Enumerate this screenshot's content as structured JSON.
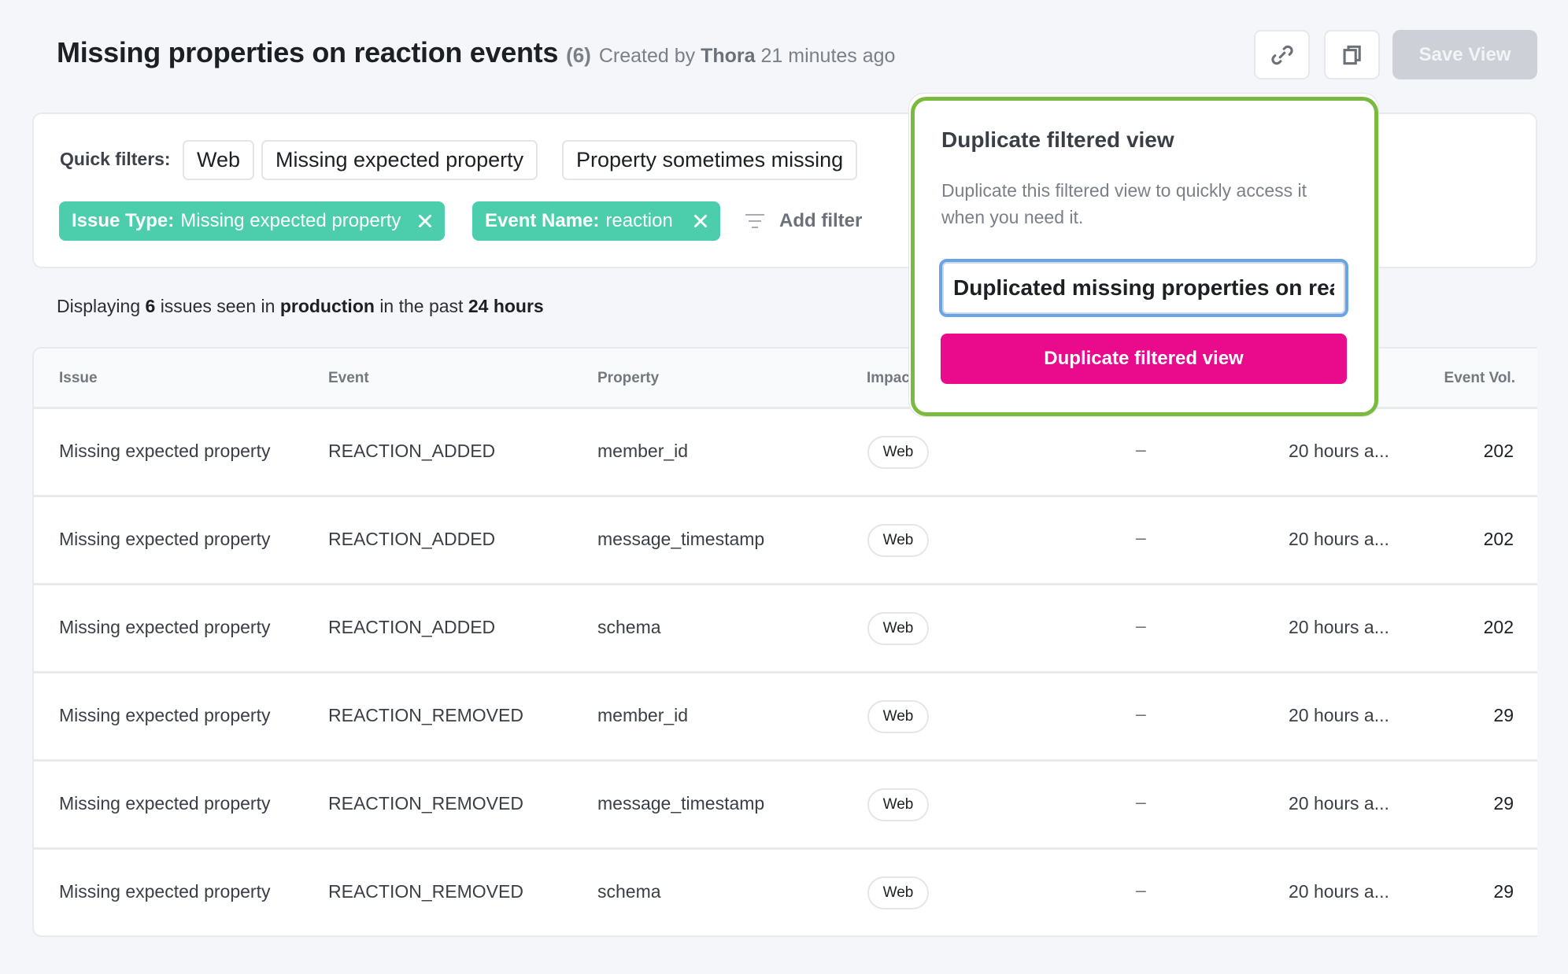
{
  "header": {
    "title": "Missing properties on reaction events",
    "count": "(6)",
    "created_prefix": "Created by",
    "creator": "Thora",
    "created_time": "21 minutes ago",
    "copy_link_icon": "link-icon",
    "duplicate_icon": "copy-icon",
    "save_label": "Save View"
  },
  "filters": {
    "quick_label": "Quick filters:",
    "quick": [
      "Web",
      "Missing expected property",
      "Property sometimes missing"
    ],
    "active": [
      {
        "key": "Issue Type:",
        "value": "Missing expected property"
      },
      {
        "key": "Event Name:",
        "value": "reaction"
      }
    ],
    "add_label": "Add filter"
  },
  "summary": {
    "prefix": "Displaying",
    "count": "6",
    "mid1": "issues seen in",
    "environment": "production",
    "mid2": "in the past",
    "period": "24 hours"
  },
  "table": {
    "columns": [
      "Issue",
      "Event",
      "Property",
      "Impac",
      "Event Vol."
    ],
    "rows": [
      {
        "issue": "Missing expected property",
        "event": "REACTION_ADDED",
        "property": "member_id",
        "impact": "Web",
        "col5": "–",
        "last_seen": "20 hours a...",
        "volume": "202"
      },
      {
        "issue": "Missing expected property",
        "event": "REACTION_ADDED",
        "property": "message_timestamp",
        "impact": "Web",
        "col5": "–",
        "last_seen": "20 hours a...",
        "volume": "202"
      },
      {
        "issue": "Missing expected property",
        "event": "REACTION_ADDED",
        "property": "schema",
        "impact": "Web",
        "col5": "–",
        "last_seen": "20 hours a...",
        "volume": "202"
      },
      {
        "issue": "Missing expected property",
        "event": "REACTION_REMOVED",
        "property": "member_id",
        "impact": "Web",
        "col5": "–",
        "last_seen": "20 hours a...",
        "volume": "29"
      },
      {
        "issue": "Missing expected property",
        "event": "REACTION_REMOVED",
        "property": "message_timestamp",
        "impact": "Web",
        "col5": "–",
        "last_seen": "20 hours a...",
        "volume": "29"
      },
      {
        "issue": "Missing expected property",
        "event": "REACTION_REMOVED",
        "property": "schema",
        "impact": "Web",
        "col5": "–",
        "last_seen": "20 hours a...",
        "volume": "29"
      }
    ]
  },
  "popover": {
    "title": "Duplicate filtered view",
    "description": "Duplicate this filtered view to quickly access it when you need it.",
    "input_value": "Duplicated missing properties on reaction events",
    "button_label": "Duplicate filtered view",
    "highlight_color": "#7aba3e",
    "button_color": "#ea0a8c"
  },
  "colors": {
    "active_filter": "#4ccdac",
    "save_disabled": "#cdd0d6"
  }
}
